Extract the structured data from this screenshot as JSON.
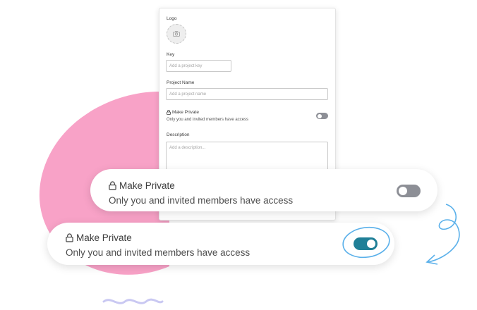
{
  "colors": {
    "blob": "#f8a2c7",
    "toggle_off": "#8d8f96",
    "toggle_on": "#1f7f97",
    "scribble": "#5ab0ea",
    "squiggle": "#c9c8f2"
  },
  "form": {
    "logo_label": "Logo",
    "key_label": "Key",
    "key_placeholder": "Add a project key",
    "name_label": "Project Name",
    "name_placeholder": "Add a project name",
    "private_title": "Make Private",
    "private_subtitle": "Only you and invited members have access",
    "private_enabled": false,
    "description_label": "Description",
    "description_placeholder": "Add a description..."
  },
  "card_off": {
    "title": "Make Private",
    "subtitle": "Only you and invited members have access",
    "enabled": false
  },
  "card_on": {
    "title": "Make Private",
    "subtitle": "Only you and invited members have access",
    "enabled": true
  },
  "icons": {
    "lock": "lock-icon",
    "camera": "camera-icon"
  }
}
